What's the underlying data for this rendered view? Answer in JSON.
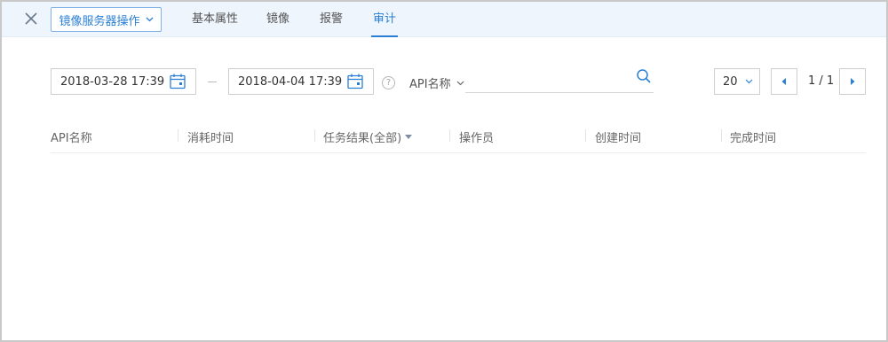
{
  "toolbar": {
    "ops_label": "镜像服务器操作"
  },
  "tabs": [
    {
      "label": "基本属性",
      "active": false
    },
    {
      "label": "镜像",
      "active": false
    },
    {
      "label": "报警",
      "active": false
    },
    {
      "label": "审计",
      "active": true
    }
  ],
  "filters": {
    "start_date": "2018-03-28 17:39",
    "end_date": "2018-04-04 17:39",
    "help_icon_text": "?",
    "api_select_label": "API名称",
    "search_value": ""
  },
  "pagination": {
    "page_size": "20",
    "page_text": "1 / 1"
  },
  "table": {
    "columns": [
      "API名称",
      "消耗时间",
      "任务结果(全部)",
      "操作员",
      "创建时间",
      "完成时间"
    ],
    "rows": []
  },
  "colors": {
    "accent": "#2a7fd4",
    "topbar_bg": "#eef5fc"
  },
  "icons": [
    "close-icon",
    "chevron-down-icon",
    "calendar-icon",
    "help-icon",
    "search-icon",
    "caret-left-icon",
    "caret-right-icon",
    "sort-triangle-icon"
  ]
}
